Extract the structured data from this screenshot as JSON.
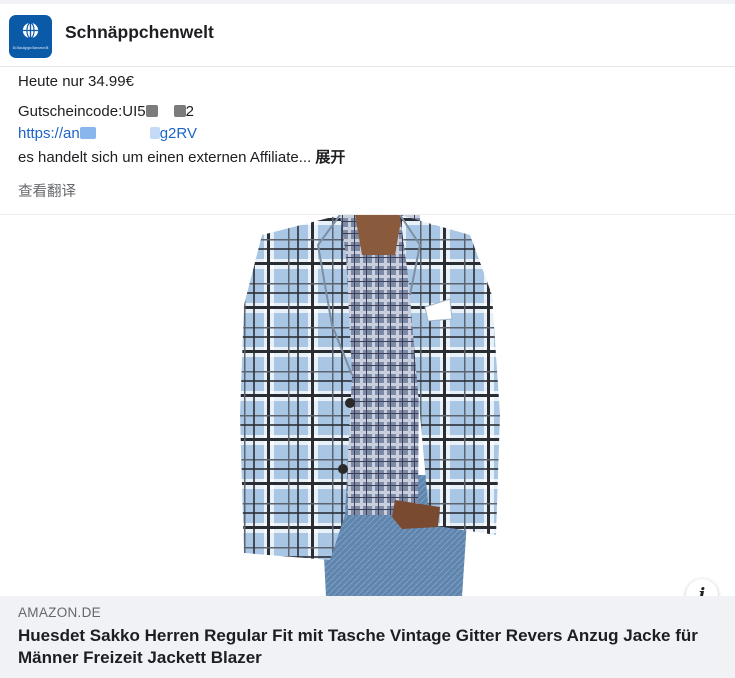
{
  "header": {
    "page_name": "Schnäppchenwelt",
    "avatar_text": "Schnäppchenwelt"
  },
  "post": {
    "line1": "Heute nur 34.99€",
    "coupon_prefix": "Gutscheincode:UI5",
    "coupon_suffix": "2",
    "link_prefix": "https://an",
    "link_suffix": "g2RV",
    "line3": "es handelt sich um einen externen Affiliate...",
    "more_label": "展开",
    "translate_label": "查看翻译"
  },
  "product_image": {
    "subject": "man in light-blue plaid blazer over checked shirt and jeans",
    "colors": {
      "jacket": "#a9c6e4",
      "check_dark": "#2a2d33",
      "check_white": "#ffffff",
      "jeans": "#5a7fa8",
      "skin": "#8a5a3c"
    }
  },
  "info_icon": "info-icon",
  "link_card": {
    "domain": "AMAZON.DE",
    "title": "Huesdet Sakko Herren Regular Fit mit Tasche Vintage Gitter Revers Anzug Jacke für Männer Freizeit Jackett Blazer"
  }
}
